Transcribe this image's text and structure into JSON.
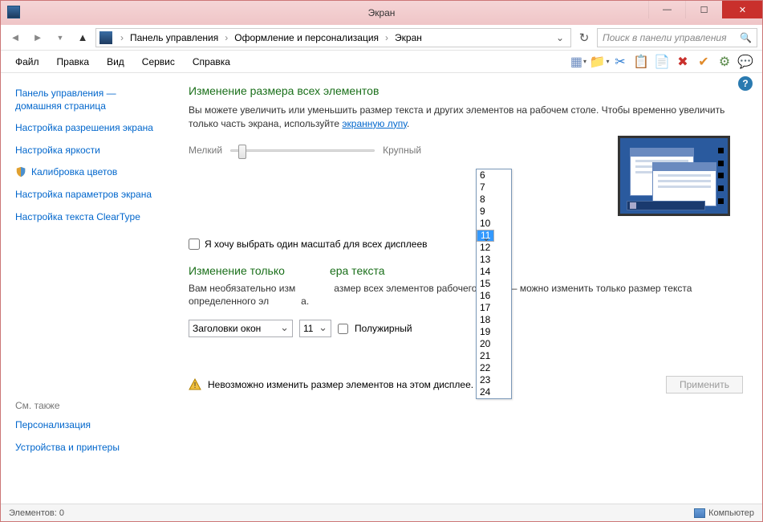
{
  "title": "Экран",
  "winbtns": {
    "min": "—",
    "max": "☐",
    "close": "✕"
  },
  "nav": {
    "back": "◄",
    "fwd": "►",
    "up": "▲",
    "crumbs": [
      "Панель управления",
      "Оформление и персонализация",
      "Экран"
    ],
    "sep": "›",
    "dropdown": "⌄",
    "refresh": "↻",
    "search_placeholder": "Поиск в панели управления",
    "search_icon": "🔍"
  },
  "menu": [
    "Файл",
    "Правка",
    "Вид",
    "Сервис",
    "Справка"
  ],
  "toolbar_icons": [
    {
      "name": "layout-icon",
      "glyph": "▦",
      "color": "#6a8abf"
    },
    {
      "name": "folder-icon",
      "glyph": "📁",
      "color": ""
    },
    {
      "name": "scissors-icon",
      "glyph": "✂",
      "color": "#2a7ad0"
    },
    {
      "name": "copy-icon",
      "glyph": "📋",
      "color": ""
    },
    {
      "name": "paste-icon",
      "glyph": "📄",
      "color": ""
    },
    {
      "name": "delete-icon",
      "glyph": "✖",
      "color": "#c9302c"
    },
    {
      "name": "check-icon",
      "glyph": "✔",
      "color": "#e08a2a"
    },
    {
      "name": "options-icon",
      "glyph": "⚙",
      "color": "#5a8a4a"
    },
    {
      "name": "chat-icon",
      "glyph": "💬",
      "color": "#2aa0c0"
    }
  ],
  "help_icon": "?",
  "sidebar": {
    "items": [
      {
        "label": "Панель управления — домашняя страница"
      },
      {
        "label": "Настройка разрешения экрана"
      },
      {
        "label": "Настройка яркости"
      },
      {
        "label": "Калибровка цветов",
        "icon": true
      },
      {
        "label": "Настройка параметров экрана"
      },
      {
        "label": "Настройка текста ClearType"
      }
    ],
    "seealso_title": "См. также",
    "seealso": [
      "Персонализация",
      "Устройства и принтеры"
    ]
  },
  "main": {
    "heading1": "Изменение размера всех элементов",
    "para1_a": "Вы можете увеличить или уменьшить размер текста и других элементов на рабочем столе. Чтобы временно увеличить только часть экрана, используйте ",
    "para1_link": "экранную лупу",
    "para1_b": ".",
    "slider_min": "Мелкий",
    "slider_max": "Крупный",
    "checkbox": "Я хочу выбрать один масштаб для всех дисплеев",
    "heading2_a": "Изменение только",
    "heading2_b": "ера текста",
    "para2_a": "Вам необязательно изм",
    "para2_b": "азмер всех элементов рабочего стола — можно изменить только размер текста определенного эл",
    "para2_c": "а.",
    "select1": "Заголовки окон",
    "select2": "11",
    "bold_label": "Полужирный",
    "warning": "Невозможно изменить размер элементов на этом дисплее.",
    "apply": "Применить"
  },
  "dropdown_options": [
    "6",
    "7",
    "8",
    "9",
    "10",
    "11",
    "12",
    "13",
    "14",
    "15",
    "16",
    "17",
    "18",
    "19",
    "20",
    "21",
    "22",
    "23",
    "24"
  ],
  "dropdown_selected": "11",
  "status": {
    "left": "Элементов: 0",
    "right": "Компьютер"
  }
}
